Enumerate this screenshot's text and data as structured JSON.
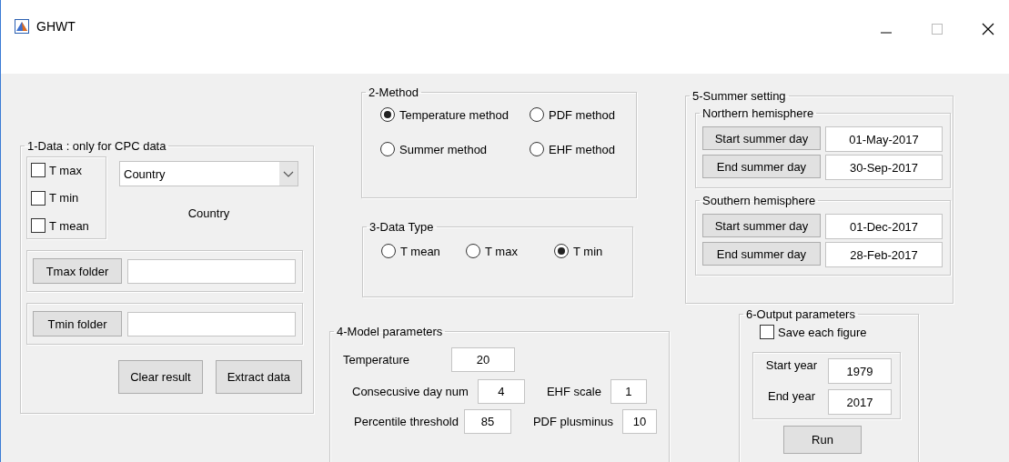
{
  "window": {
    "title": "GHWT"
  },
  "data": {
    "title": "1-Data : only for CPC data",
    "checkboxes": [
      {
        "label": "T max",
        "checked": false
      },
      {
        "label": "T min",
        "checked": false
      },
      {
        "label": "T mean",
        "checked": false
      }
    ],
    "dropdown": {
      "value": "Country"
    },
    "dropdown_label": "Country",
    "folders": [
      {
        "button": "Tmax folder"
      },
      {
        "button": "Tmin folder"
      }
    ],
    "buttons": [
      "Clear result",
      "Extract data"
    ]
  },
  "method": {
    "title": "2-Method",
    "options": [
      {
        "label": "Temperature method",
        "selected": true
      },
      {
        "label": "PDF method",
        "selected": false
      },
      {
        "label": "Summer method",
        "selected": false
      },
      {
        "label": "EHF method",
        "selected": false
      }
    ]
  },
  "data_type": {
    "title": "3-Data Type",
    "options": [
      {
        "label": "T mean",
        "selected": false
      },
      {
        "label": "T max",
        "selected": false
      },
      {
        "label": "T min",
        "selected": true
      }
    ]
  },
  "model_parameters": {
    "title": "4-Model parameters",
    "rows": [
      [
        {
          "label": "Temperature",
          "value": "20"
        }
      ],
      [
        {
          "label": "Consecusive day num",
          "value": "4"
        },
        {
          "label": "EHF scale",
          "value": "1"
        }
      ],
      [
        {
          "label": "Percentile threshold",
          "value": "85"
        },
        {
          "label": "PDF plusminus",
          "value": "10"
        }
      ]
    ]
  },
  "summer_setting": {
    "title": "5-Summer setting",
    "groups": [
      {
        "title": "Northern hemisphere",
        "rows": [
          {
            "button": "Start summer day",
            "value": "01-May-2017"
          },
          {
            "button": "End summer day",
            "value": "30-Sep-2017"
          }
        ]
      },
      {
        "title": "Southern hemisphere",
        "rows": [
          {
            "button": "Start summer day",
            "value": "01-Dec-2017"
          },
          {
            "button": "End summer day",
            "value": "28-Feb-2017"
          }
        ]
      }
    ]
  },
  "output_parameters": {
    "title": "6-Output parameters",
    "checkbox": {
      "label": "Save each figure",
      "checked": false
    },
    "years": [
      {
        "label": "Start year",
        "value": "1979"
      },
      {
        "label": "End year",
        "value": "2017"
      }
    ],
    "button": "Run"
  }
}
